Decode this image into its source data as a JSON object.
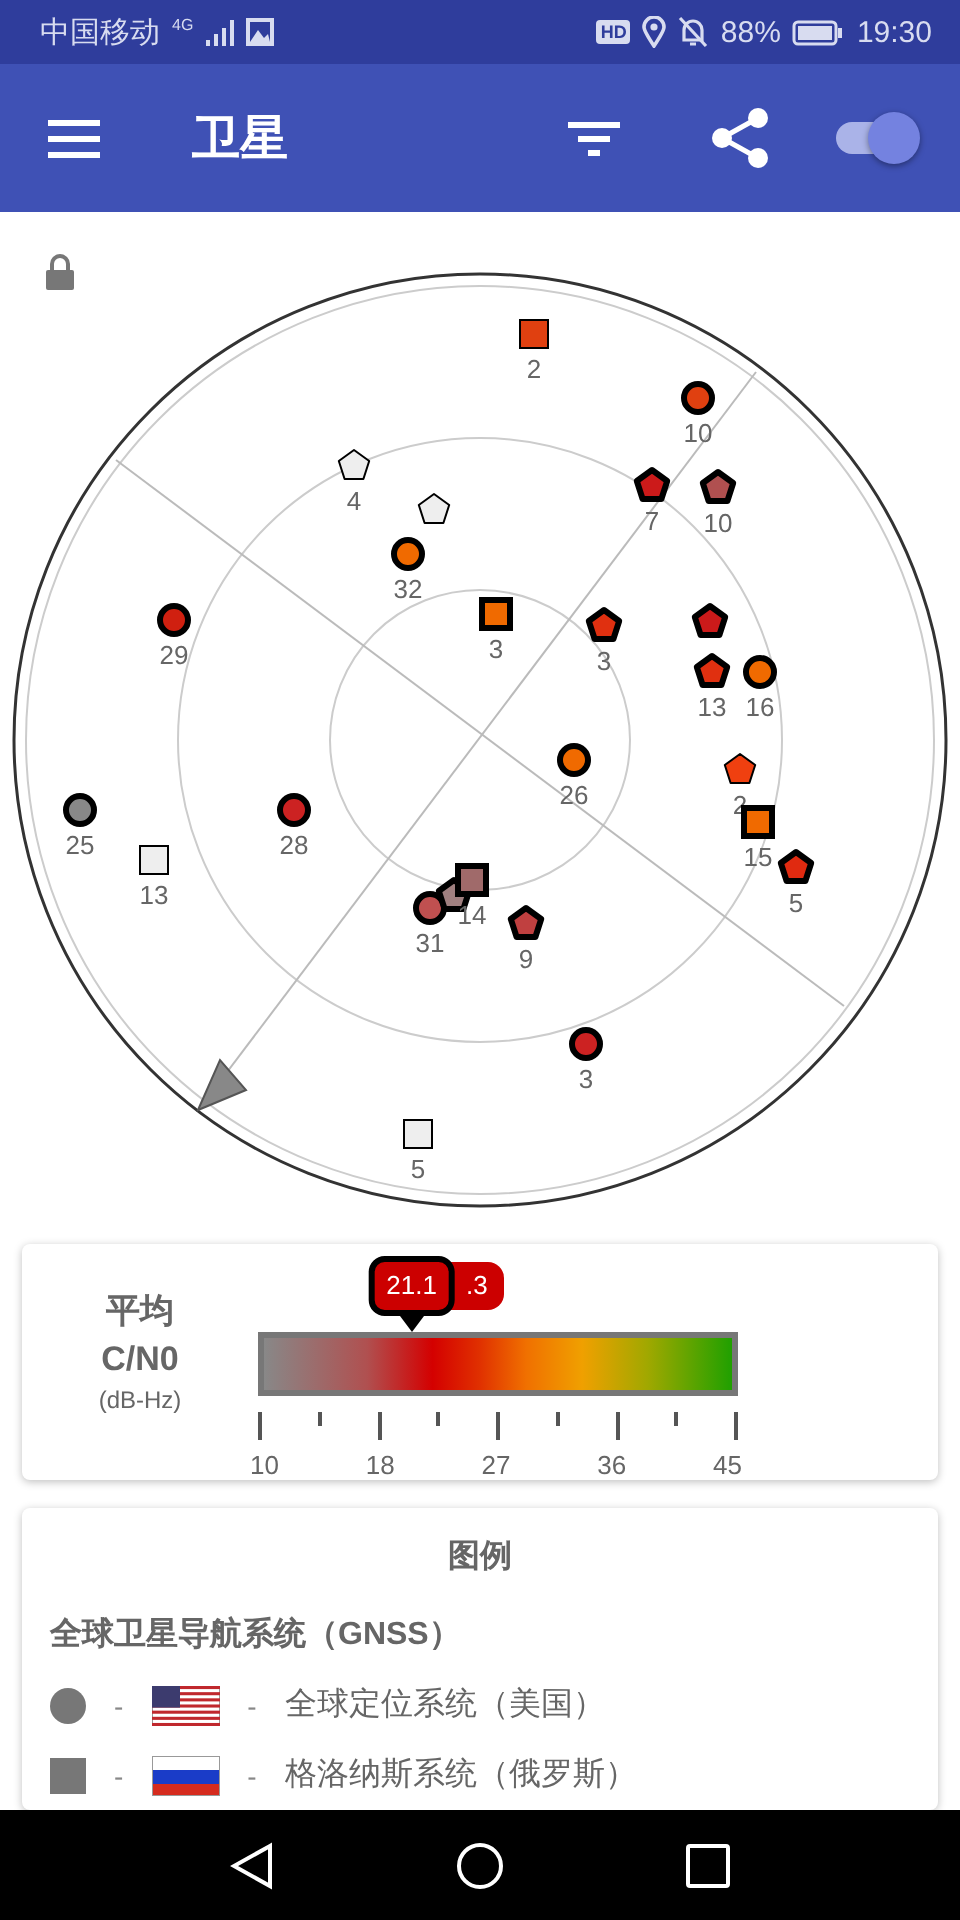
{
  "status_bar": {
    "carrier": "中国移动",
    "network": "4G",
    "hd": "HD",
    "battery": "88%",
    "time": "19:30"
  },
  "app_bar": {
    "title": "卫星",
    "switch_on": true
  },
  "satellites": [
    {
      "kind": "square",
      "color": "#e04010",
      "used": false,
      "label": "2"
    },
    {
      "kind": "circle",
      "color": "#e04010",
      "used": true,
      "label": "10"
    },
    {
      "kind": "pentagon",
      "color": "#eeeeee",
      "used": false,
      "label": "4"
    },
    {
      "kind": "pentagon",
      "color": "#eeeeee",
      "used": false
    },
    {
      "kind": "pentagon",
      "color": "#cc1a1a",
      "used": true,
      "label": "7"
    },
    {
      "kind": "pentagon",
      "color": "#b05050",
      "used": true,
      "label": "10"
    },
    {
      "kind": "circle",
      "color": "#f06a00",
      "used": true,
      "label": "32"
    },
    {
      "kind": "circle",
      "color": "#d02010",
      "used": true,
      "label": "29"
    },
    {
      "kind": "square",
      "color": "#f06a00",
      "used": true,
      "label": "3"
    },
    {
      "kind": "pentagon",
      "color": "#e03010",
      "used": true,
      "label": "3"
    },
    {
      "kind": "pentagon",
      "color": "#cc1a1a",
      "used": true
    },
    {
      "kind": "pentagon",
      "color": "#e03010",
      "used": true,
      "label": "13"
    },
    {
      "kind": "circle",
      "color": "#f06a00",
      "used": true,
      "label": "16"
    },
    {
      "kind": "circle",
      "color": "#888888",
      "used": true,
      "label": "25"
    },
    {
      "kind": "square",
      "color": "#eeeeee",
      "used": false,
      "label": "13"
    },
    {
      "kind": "circle",
      "color": "#cc2222",
      "used": true,
      "label": "28"
    },
    {
      "kind": "circle",
      "color": "#c05050",
      "used": true,
      "label": "31"
    },
    {
      "kind": "pentagon",
      "color": "#a08080",
      "used": true
    },
    {
      "kind": "square",
      "color": "#a06a6a",
      "used": true,
      "label": "14"
    },
    {
      "kind": "pentagon",
      "color": "#c04040",
      "used": true,
      "label": "9"
    },
    {
      "kind": "circle",
      "color": "#f06a00",
      "used": true,
      "label": "26"
    },
    {
      "kind": "pentagon",
      "color": "#f04010",
      "used": false,
      "label": "2"
    },
    {
      "kind": "square",
      "color": "#f06a00",
      "used": true,
      "label": "15"
    },
    {
      "kind": "pentagon",
      "color": "#e02a10",
      "used": true,
      "label": "5"
    },
    {
      "kind": "circle",
      "color": "#cc2222",
      "used": true,
      "label": "3"
    },
    {
      "kind": "square",
      "color": "#eeeeee",
      "used": false,
      "label": "5"
    }
  ],
  "cn0": {
    "title": "平均",
    "quantity": "C/N0",
    "unit": "(dB-Hz)",
    "value": {
      "text": "21.1",
      "level": 0.32
    },
    "second_value": ".3",
    "ticks": [
      "10",
      "18",
      "27",
      "36",
      "45"
    ]
  },
  "legend": {
    "title": "图例",
    "section": "全球卫星导航系统（GNSS）",
    "rows": [
      {
        "symbol": {
          "kind": "circle"
        },
        "flag": {
          "kind": "usa"
        },
        "dash_1": "-",
        "dash_2": "-",
        "name": "全球定位系统（美国）"
      },
      {
        "symbol": {
          "kind": "square"
        },
        "flag": {
          "kind": "russia"
        },
        "dash_1": "-",
        "dash_2": "-",
        "name": "格洛纳斯系统（俄罗斯）"
      }
    ]
  }
}
